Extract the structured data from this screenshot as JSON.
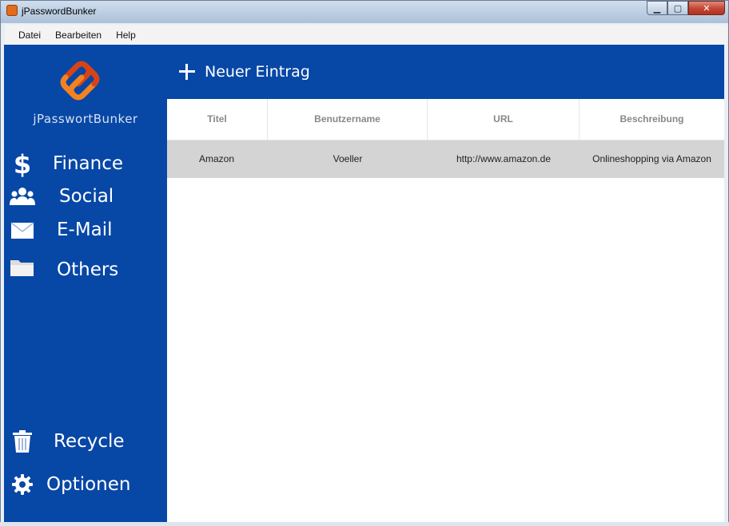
{
  "window": {
    "title": "jPasswordBunker",
    "minimize_glyph": "▁",
    "maximize_glyph": "▢",
    "close_glyph": "✕"
  },
  "menu": [
    "Datei",
    "Bearbeiten",
    "Help"
  ],
  "sidebar": {
    "brand": "jPasswortBunker",
    "categories": [
      {
        "label": "Finance",
        "icon": "dollar-icon"
      },
      {
        "label": "Social",
        "icon": "people-icon"
      },
      {
        "label": "E-Mail",
        "icon": "envelope-icon"
      },
      {
        "label": "Others",
        "icon": "folder-icon"
      }
    ],
    "bottom": [
      {
        "label": "Recycle",
        "icon": "trash-icon"
      },
      {
        "label": "Optionen",
        "icon": "gear-icon"
      }
    ]
  },
  "toolbar": {
    "new_entry_label": "Neuer Eintrag"
  },
  "table": {
    "columns": [
      "Titel",
      "Benutzername",
      "URL",
      "Beschreibung"
    ],
    "rows": [
      [
        "Amazon",
        "Voeller",
        "http://www.amazon.de",
        "Onlineshopping via Amazon"
      ]
    ]
  },
  "colors": {
    "sidebar": "#0747a6",
    "logo_orange": "#f58220",
    "row_selected": "#d4d4d4"
  }
}
